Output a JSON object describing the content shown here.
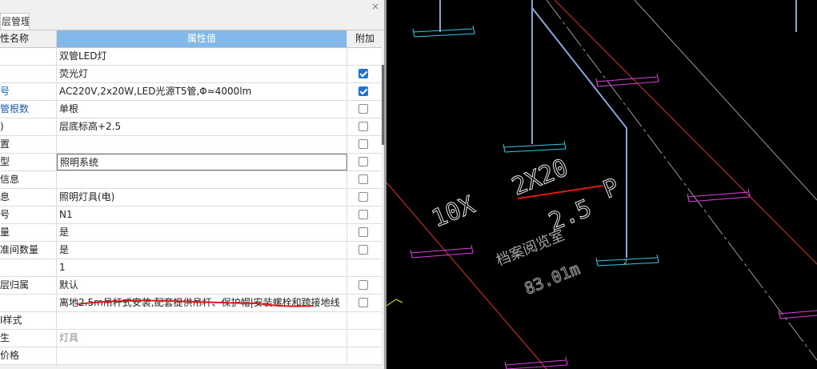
{
  "panel": {
    "tab_label": "层管理",
    "close_glyph": "×",
    "header": {
      "name": "性名称",
      "value": "属性值",
      "extra": "附加"
    },
    "rows": [
      {
        "name": "",
        "value": "双管LED灯",
        "checkbox": null
      },
      {
        "name": "",
        "value": "荧光灯",
        "checkbox": true
      },
      {
        "name": "号",
        "value": "AC220V,2x20W,LED光源T5管,Φ≈4000lm",
        "checkbox": true
      },
      {
        "name": "管根数",
        "value": "单根",
        "checkbox": false
      },
      {
        "name": ")",
        "value": "层底标高+2.5",
        "checkbox": false
      },
      {
        "name": "置",
        "value": "",
        "checkbox": false
      },
      {
        "name": "型",
        "value": "照明系统",
        "checkbox": false
      },
      {
        "name": "信息",
        "value": "",
        "checkbox": false
      },
      {
        "name": "息",
        "value": "照明灯具(电)",
        "checkbox": false
      },
      {
        "name": "号",
        "value": "N1",
        "checkbox": false
      },
      {
        "name": "量",
        "value": "是",
        "checkbox": false
      },
      {
        "name": "准间数量",
        "value": "是",
        "checkbox": false
      },
      {
        "name": "",
        "value": "1",
        "checkbox": null
      },
      {
        "name": "层归属",
        "value": "默认",
        "checkbox": false
      },
      {
        "name": "",
        "value": "离地2.5m吊杆式安装,配套提供吊杆、保护帽|安装螺栓和跨接地线",
        "checkbox": false
      },
      {
        "name": "I样式",
        "value": "",
        "checkbox": null
      },
      {
        "name": "生",
        "value": "灯具",
        "checkbox": null
      },
      {
        "name": "价格",
        "value": "",
        "checkbox": null
      }
    ]
  },
  "cad": {
    "label_qty": "10X",
    "label_spec": "2X20",
    "label_p": "P",
    "label_height": "2.5",
    "room_name": "档案阅览室",
    "room_area": "83.01m",
    "fixture_number": "2"
  },
  "colors": {
    "header_blue": "#84b8e8",
    "name_blue": "#1a5fb4",
    "cad_cyan": "#33c8e6",
    "cad_magenta": "#e03ce0",
    "cad_red": "#e03020",
    "cad_grey": "#9a9a9a",
    "cad_blue": "#8aa6d8",
    "annotation_red": "#e01818"
  }
}
